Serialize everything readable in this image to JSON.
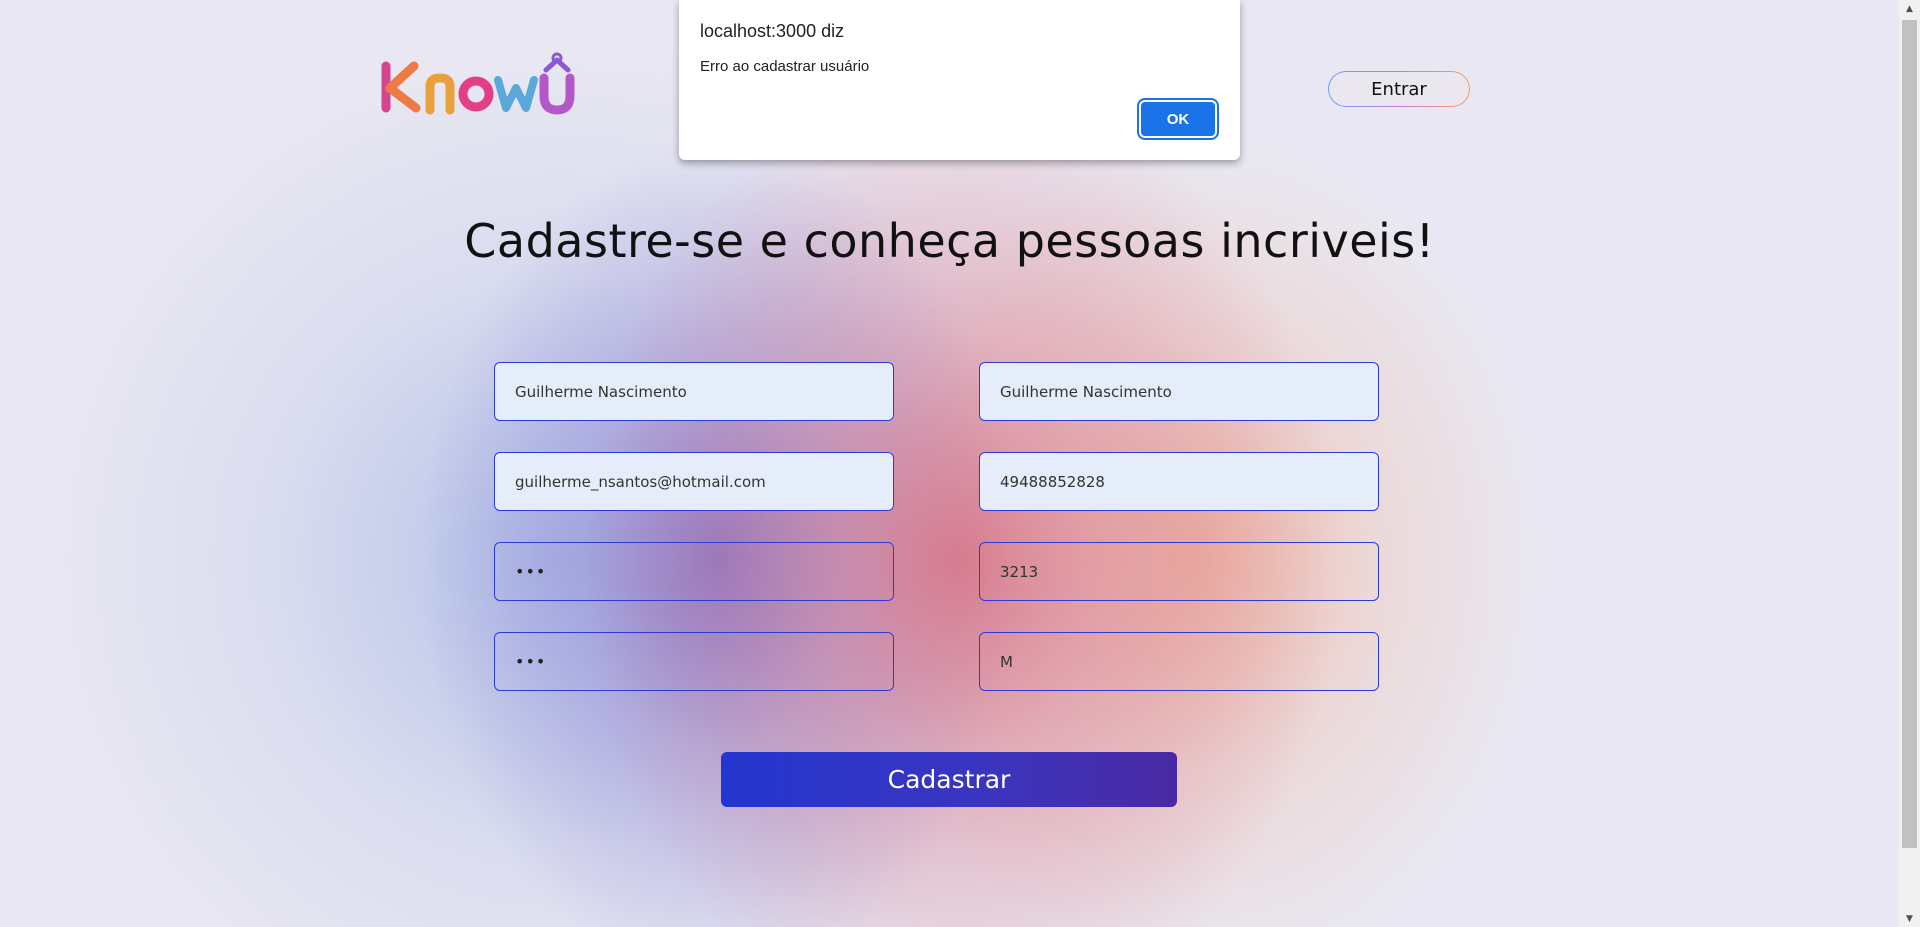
{
  "header": {
    "logo_text": "KnowÛ",
    "login_label": "Entrar"
  },
  "main": {
    "title": "Cadastre-se e conheça pessoas incriveis!",
    "fields": {
      "name": "Guilherme Nascimento",
      "name_2": "Guilherme Nascimento",
      "email": "guilherme_nsantos@hotmail.com",
      "cpf": "49488852828",
      "password_masked": "•••",
      "number": "3213",
      "confirm_password_masked": "•••",
      "gender": "M"
    },
    "submit_label": "Cadastrar"
  },
  "alert": {
    "title": "localhost:3000 diz",
    "message": "Erro ao cadastrar usuário",
    "ok_label": "OK"
  },
  "colors": {
    "field_border": "#2c3bd6",
    "field_filled_bg": "#e6edfa",
    "button_gradient_start": "#2436cf",
    "button_gradient_end": "#4a2aa3",
    "dialog_button": "#1a73e8"
  },
  "icons": {
    "scroll_up": "scroll-up-arrow-icon",
    "scroll_down": "scroll-down-arrow-icon"
  }
}
